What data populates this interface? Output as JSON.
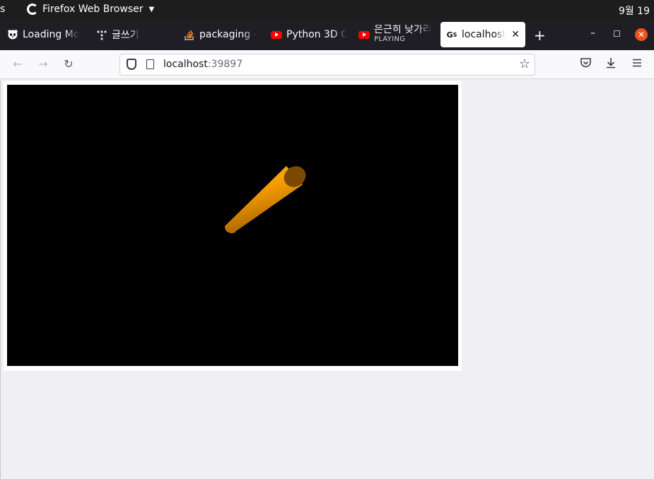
{
  "topbar": {
    "activities": "s",
    "app_name": "Firefox Web Browser",
    "clock": "9월 19"
  },
  "tabs": [
    {
      "title": "Loading Mo",
      "icon": "panda-icon"
    },
    {
      "title": "글쓰기",
      "icon": "tistory-icon"
    },
    {
      "title": "packaging -",
      "icon": "stackoverflow-icon"
    },
    {
      "title": "Python 3D C",
      "icon": "youtube-icon"
    },
    {
      "title": "은근히 낮가리",
      "subtitle": "PLAYING",
      "icon": "youtube-icon"
    },
    {
      "title": "localhost:",
      "icon": "gs-icon",
      "active": true
    }
  ],
  "urlbar": {
    "host": "localhost",
    "port": ":39897"
  },
  "scene": {
    "background": "#000000",
    "object_color": "#f39c00"
  }
}
